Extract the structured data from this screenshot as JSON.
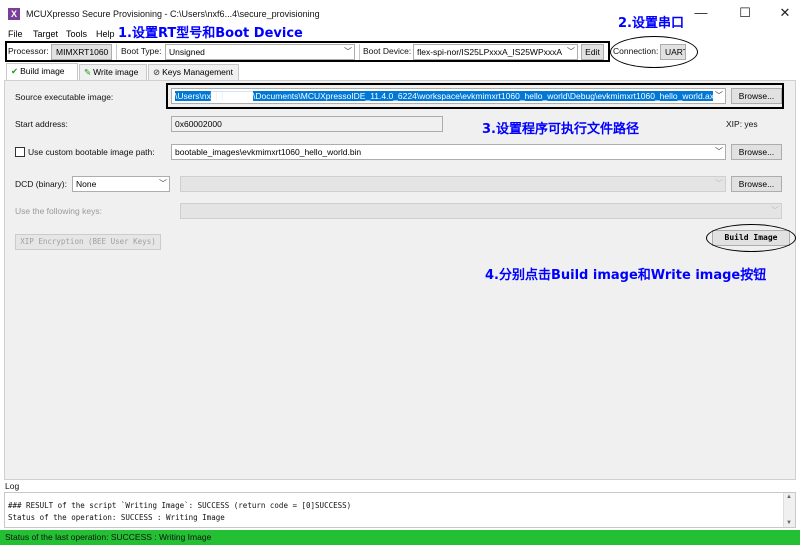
{
  "window": {
    "title": "MCUXpresso Secure Provisioning - C:\\Users\\nxf6...4\\secure_provisioning",
    "app_icon_glyph": "X",
    "buttons": {
      "minimize": "—",
      "maximize": "☐",
      "close": "✕"
    }
  },
  "menu": [
    "File",
    "Target",
    "Tools",
    "Help"
  ],
  "annotations": {
    "a1": "1.设置RT型号和Boot Device",
    "a2": "2.设置串口",
    "a3": "3.设置程序可执行文件路径",
    "a4": "4.分别点击Build image和Write image按钮"
  },
  "toolbar": {
    "processor_label": "Processor:",
    "processor_value": "MIMXRT1060",
    "boot_type_label": "Boot Type:",
    "boot_type_value": "Unsigned",
    "boot_device_label": "Boot Device:",
    "boot_device_value": "flex-spi-nor/IS25LPxxxA_IS25WPxxxA",
    "edit_label": "Edit",
    "connection_label": "Connection:",
    "connection_value": "UART"
  },
  "tabs": [
    {
      "label": "Build image",
      "icon": "check-icon",
      "active": true
    },
    {
      "label": "Write image",
      "icon": "pencil-icon",
      "active": false
    },
    {
      "label": "Keys Management",
      "icon": "no-key-icon",
      "active": false
    }
  ],
  "build": {
    "source_label": "Source executable image:",
    "source_value": "\\Users\\nx███████\\Documents\\MCUXpressoIDE_11.4.0_6224\\workspace\\evkmimxrt1060_hello_world\\Debug\\evkmimxrt1060_hello_world.axf",
    "browse_label": "Browse...",
    "start_label": "Start address:",
    "start_value": "0x60002000",
    "xip_label": "XIP: yes",
    "custom_label": "Use custom bootable image path:",
    "custom_value": "bootable_images\\evkmimxrt1060_hello_world.bin",
    "dcd_label": "DCD (binary):",
    "dcd_value": "None",
    "keys_label": "Use the following keys:",
    "xip_enc_label": "XIP Encryption (BEE User Keys)",
    "build_button": "Build Image"
  },
  "log": {
    "label": "Log",
    "lines": [
      "### RESULT of the script `Writing Image`: SUCCESS (return code = [0]SUCCESS)",
      "Status of the operation: SUCCESS : Writing Image"
    ]
  },
  "status": {
    "text": "Status of the last operation: SUCCESS : Writing Image",
    "color": "#22c032"
  }
}
